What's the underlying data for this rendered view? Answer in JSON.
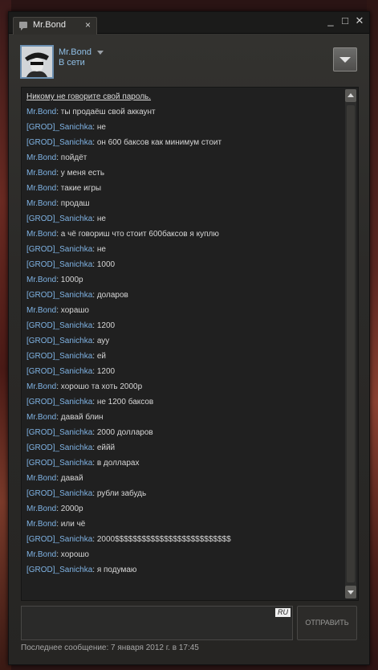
{
  "window": {
    "tab_title": "Mr.Bond",
    "tab_close": "×",
    "minimize": "_",
    "maximize": "□",
    "close": "✕"
  },
  "friend": {
    "name": "Mr.Bond",
    "status": "В сети"
  },
  "chat": {
    "notice": "Никому не говорите свой пароль.",
    "messages": [
      {
        "sender": "Mr.Bond",
        "text": ": ты продаёш свой аккаунт"
      },
      {
        "sender": "[GROD]_Sanichka",
        "text": ": не"
      },
      {
        "sender": "[GROD]_Sanichka",
        "text": ": он 600 баксов как минимум стоит"
      },
      {
        "sender": "Mr.Bond",
        "text": ": пойдёт"
      },
      {
        "sender": "Mr.Bond",
        "text": ": у меня есть"
      },
      {
        "sender": "Mr.Bond",
        "text": ": такие игры"
      },
      {
        "sender": "Mr.Bond",
        "text": ": продаш"
      },
      {
        "sender": "[GROD]_Sanichka",
        "text": ": не"
      },
      {
        "sender": "Mr.Bond",
        "text": ": а чё говориш что стоит 600баксов я куплю"
      },
      {
        "sender": "[GROD]_Sanichka",
        "text": ": не"
      },
      {
        "sender": "[GROD]_Sanichka",
        "text": ": 1000"
      },
      {
        "sender": "Mr.Bond",
        "text": ": 1000р"
      },
      {
        "sender": "[GROD]_Sanichka",
        "text": ": доларов"
      },
      {
        "sender": "Mr.Bond",
        "text": ": хорашо"
      },
      {
        "sender": "[GROD]_Sanichka",
        "text": ": 1200"
      },
      {
        "sender": "[GROD]_Sanichka",
        "text": ": ауу"
      },
      {
        "sender": "[GROD]_Sanichka",
        "text": ": ей"
      },
      {
        "sender": "[GROD]_Sanichka",
        "text": ": 1200"
      },
      {
        "sender": "Mr.Bond",
        "text": ": хорошо та хоть 2000р"
      },
      {
        "sender": "[GROD]_Sanichka",
        "text": ": не 1200 баксов"
      },
      {
        "sender": "Mr.Bond",
        "text": ": давай блин"
      },
      {
        "sender": "[GROD]_Sanichka",
        "text": ": 2000 долларов"
      },
      {
        "sender": "[GROD]_Sanichka",
        "text": ": еййй"
      },
      {
        "sender": "[GROD]_Sanichka",
        "text": ": в долларах"
      },
      {
        "sender": "Mr.Bond",
        "text": ": давай"
      },
      {
        "sender": "[GROD]_Sanichka",
        "text": ": рубли забудь"
      },
      {
        "sender": "Mr.Bond",
        "text": ": 2000р"
      },
      {
        "sender": "Mr.Bond",
        "text": ": или чё"
      },
      {
        "sender": "[GROD]_Sanichka",
        "text": ": 2000$$$$$$$$$$$$$$$$$$$$$$$$$$"
      },
      {
        "sender": "Mr.Bond",
        "text": ": хорошо"
      },
      {
        "sender": "[GROD]_Sanichka",
        "text": ": я подумаю"
      }
    ]
  },
  "input": {
    "value": "",
    "language_badge": "RU",
    "send_label": "ОТПРАВИТЬ"
  },
  "footer": {
    "last_message": "Последнее сообщение: 7 января 2012 г. в 17:45"
  },
  "colors": {
    "sender": "#7fb3e4",
    "message_text": "#d6d6d6",
    "window_bg": "#2b2a28",
    "chat_bg": "#202020"
  }
}
